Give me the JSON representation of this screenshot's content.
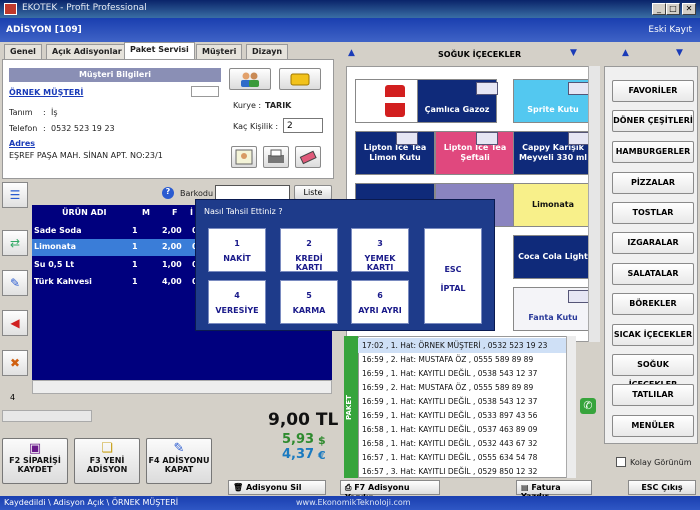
{
  "window": {
    "title": "EKOTEK - Profit Professional",
    "controls": [
      "_",
      "□",
      "✕"
    ]
  },
  "header": {
    "left": "ADİSYON [109]",
    "right": "Eski Kayıt"
  },
  "tabs": [
    "Genel",
    "Açık Adisyonlar",
    "Paket Servisi",
    "Müşteri",
    "Dizayn"
  ],
  "active_tab": "Paket Servisi",
  "customer": {
    "section_title": "Müşteri Bilgileri",
    "name_link": "ÖRNEK MÜŞTERİ",
    "tanim_label": "Tanım",
    "tanim_value": "İş",
    "telefon_label": "Telefon",
    "telefon_value": "0532 523 19 23",
    "adres_link": "Adres",
    "adres_value": "EŞREF PAŞA MAH. SİNAN APT. NO:23/1",
    "kurye_label": "Kurye :",
    "kurye_value": "TARIK",
    "kisilik_label": "Kaç Kişilik :",
    "kisilik_value": "2"
  },
  "barcode": {
    "label": "Barkodu",
    "list_btn": "Liste"
  },
  "order_grid": {
    "headers": [
      "ÜRÜN ADI",
      "M",
      "F",
      "İ"
    ],
    "rows": [
      {
        "name": "Sade Soda",
        "m": "1",
        "f": "2,00",
        "i": "0"
      },
      {
        "name": "Limonata",
        "m": "1",
        "f": "2,00",
        "i": "0"
      },
      {
        "name": "Su 0,5 Lt",
        "m": "1",
        "f": "1,00",
        "i": "0"
      },
      {
        "name": "Türk Kahvesi",
        "m": "1",
        "f": "4,00",
        "i": "0"
      }
    ],
    "selected_index": 1,
    "count": "4"
  },
  "totals": {
    "tl": "9,00 TL",
    "usd": "5,93",
    "usd_sym": "$",
    "eur": "4,37",
    "eur_sym": "€"
  },
  "bottom_buttons": [
    {
      "line1": "F2 SİPARİŞİ",
      "line2": "KAYDET"
    },
    {
      "line1": "F3 YENİ",
      "line2": "ADİSYON"
    },
    {
      "line1": "F4 ADİSYONU",
      "line2": "KAPAT"
    }
  ],
  "products": {
    "category_title": "SOĞUK İÇECEKLER",
    "items": [
      "Çamlıca Gazoz",
      "Sprite Kutu",
      "Lipton Ice Tea Limon Kutu",
      "Lipton Ice Tea Şeftali",
      "Cappy Karışık Meyveli 330 ml",
      "Limonata",
      "Coca Cola Light",
      "Fanta Kutu"
    ]
  },
  "categories": [
    "FAVORİLER",
    "DÖNER ÇEŞİTLERİ",
    "HAMBURGERLER",
    "PİZZALAR",
    "TOSTLAR",
    "IZGARALAR",
    "SALATALAR",
    "BÖREKLER",
    "SICAK İÇECEKLER",
    "SOĞUK İÇECEKLER",
    "TATLILAR",
    "MENÜLER"
  ],
  "kolay_gorunum": "Kolay Görünüm",
  "dialog": {
    "title": "Nasıl Tahsil Ettiniz ?",
    "buttons": [
      {
        "num": "1",
        "label": "NAKİT"
      },
      {
        "num": "2",
        "label": "KREDİ KARTI"
      },
      {
        "num": "3",
        "label": "YEMEK KARTI"
      },
      {
        "num": "4",
        "label": "VERESİYE"
      },
      {
        "num": "5",
        "label": "KARMA"
      },
      {
        "num": "6",
        "label": "AYRI AYRI"
      }
    ],
    "cancel": {
      "line1": "ESC",
      "line2": "İPTAL"
    }
  },
  "paket_label": "PAKET",
  "phone_log": [
    "17:02 , 1. Hat: ÖRNEK MÜŞTERİ , 0532 523 19 23",
    "16:59 , 2. Hat: MUSTAFA ÖZ , 0555 589 89 89",
    "16:59 , 1. Hat: KAYITLI DEĞİL , 0538 543 12 37",
    "16:59 , 2. Hat: MUSTAFA ÖZ , 0555 589 89 89",
    "16:59 , 1. Hat: KAYITLI DEĞİL , 0538 543 12 37",
    "16:59 , 1. Hat: KAYITLI DEĞİL , 0533 897 43 56",
    "16:58 , 1. Hat: KAYITLI DEĞİL , 0537 463 89 09",
    "16:58 , 1. Hat: KAYITLI DEĞİL , 0532 443 67 32",
    "16:57 , 1. Hat: KAYITLI DEĞİL , 0555 634 54 78",
    "16:57 , 3. Hat: KAYITLI DEĞİL , 0529 850 12 32"
  ],
  "footer_buttons": [
    "Adisyonu Sil",
    "F7 Adisyonu Yazdır",
    "Fatura Yazdır",
    "ESC Çıkış"
  ],
  "status": {
    "left": "Kaydedildi \\ Adisyon Açık \\ ÖRNEK MÜŞTERİ",
    "center": "www.EkonomikTeknoloji.com"
  },
  "colors": {
    "accent": "#1a3fb0",
    "grid_bg": "#00007e",
    "selected_row": "#3a7dd8",
    "dialog_bg": "#1e3b8a",
    "paket_green": "#37a43c"
  }
}
